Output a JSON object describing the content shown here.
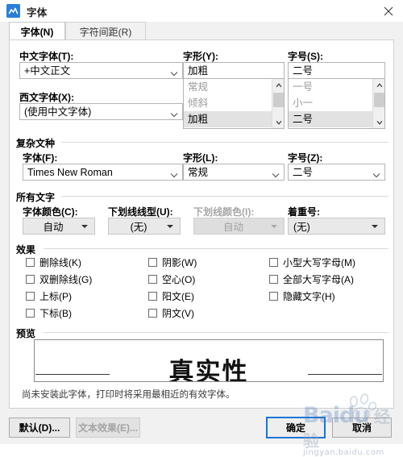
{
  "window": {
    "title": "字体",
    "icon": "wps-writer-icon",
    "close_label": "×"
  },
  "tabs": [
    {
      "label": "字体(N)",
      "active": true
    },
    {
      "label": "字符间距(R)",
      "active": false
    }
  ],
  "latin_section": {
    "chinese_font": {
      "label": "中文字体(T):",
      "value": "+中文正文",
      "selected": true
    },
    "western_font": {
      "label": "西文字体(X):",
      "value": "(使用中文字体)"
    },
    "style": {
      "label": "字形(Y):",
      "value": "加粗",
      "options": [
        "常规",
        "倾斜",
        "加粗"
      ],
      "selected_option": "加粗"
    },
    "size": {
      "label": "字号(S):",
      "value": "二号",
      "options": [
        "一号",
        "小一",
        "二号"
      ],
      "selected_option": "二号"
    }
  },
  "complex_script": {
    "group_title": "复杂文种",
    "font": {
      "label": "字体(F):",
      "value": "Times New Roman"
    },
    "style": {
      "label": "字形(L):",
      "value": "常规"
    },
    "size": {
      "label": "字号(Z):",
      "value": "二号"
    }
  },
  "all_text": {
    "group_title": "所有文字",
    "font_color": {
      "label": "字体颜色(C):",
      "value": "自动",
      "disabled": false
    },
    "underline_style": {
      "label": "下划线线型(U):",
      "value": "(无)",
      "disabled": false
    },
    "underline_color": {
      "label": "下划线颜色(I):",
      "value": "自动",
      "disabled": true
    },
    "emphasis_mark": {
      "label": "着重号:",
      "value": "(无)",
      "disabled": false
    }
  },
  "effects": {
    "group_title": "效果",
    "column1": [
      {
        "label": "删除线(K)",
        "checked": false
      },
      {
        "label": "双删除线(G)",
        "checked": false
      },
      {
        "label": "上标(P)",
        "checked": false
      },
      {
        "label": "下标(B)",
        "checked": false
      }
    ],
    "column2": [
      {
        "label": "阴影(W)",
        "checked": false
      },
      {
        "label": "空心(O)",
        "checked": false
      },
      {
        "label": "阳文(E)",
        "checked": false
      },
      {
        "label": "阴文(V)",
        "checked": false
      }
    ],
    "column3": [
      {
        "label": "小型大写字母(M)",
        "checked": false
      },
      {
        "label": "全部大写字母(A)",
        "checked": false
      },
      {
        "label": "隐藏文字(H)",
        "checked": false
      }
    ]
  },
  "preview": {
    "group_title": "预览",
    "sample_text": "真实性",
    "note": "尚未安装此字体，打印时将采用最相近的有效字体。"
  },
  "footer": {
    "default_button": "默认(D)...",
    "text_effects_button": "文本效果(E)...",
    "ok_button": "确定",
    "cancel_button": "取消"
  },
  "watermark": {
    "brand": "Baidu",
    "brand_cn": "经验",
    "subtext": "jingyan.baidu.com"
  },
  "colors": {
    "accent": "#2a7fff",
    "primary_border": "#1d74d6",
    "dialog_bg": "#f1f1f1",
    "panel_bg": "#ffffff"
  }
}
